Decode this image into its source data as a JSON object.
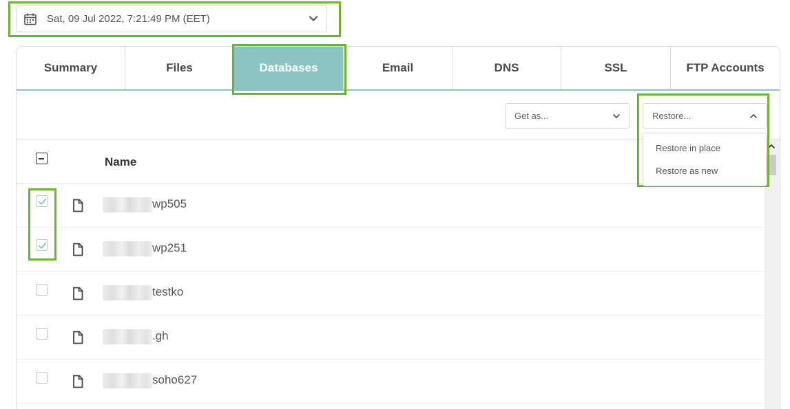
{
  "date_picker": {
    "value": "Sat, 09 Jul 2022, 7:21:49 PM (EET)",
    "icon": "calendar-icon"
  },
  "tabs": [
    {
      "label": "Summary",
      "active": false
    },
    {
      "label": "Files",
      "active": false
    },
    {
      "label": "Databases",
      "active": true
    },
    {
      "label": "Email",
      "active": false
    },
    {
      "label": "DNS",
      "active": false
    },
    {
      "label": "SSL",
      "active": false
    },
    {
      "label": "FTP Accounts",
      "active": false
    }
  ],
  "toolbar": {
    "get_as_label": "Get as...",
    "restore_label": "Restore...",
    "restore_options": [
      "Restore in place",
      "Restore as new"
    ]
  },
  "table": {
    "name_header": "Name",
    "rows": [
      {
        "name": "wp505",
        "checked": true
      },
      {
        "name": "wp251",
        "checked": true
      },
      {
        "name": "testko",
        "checked": false
      },
      {
        "name": ".gh",
        "checked": false
      },
      {
        "name": "soho627",
        "checked": false
      }
    ]
  },
  "colors": {
    "accent": "#8cc3c3",
    "highlight": "#6cb531"
  }
}
